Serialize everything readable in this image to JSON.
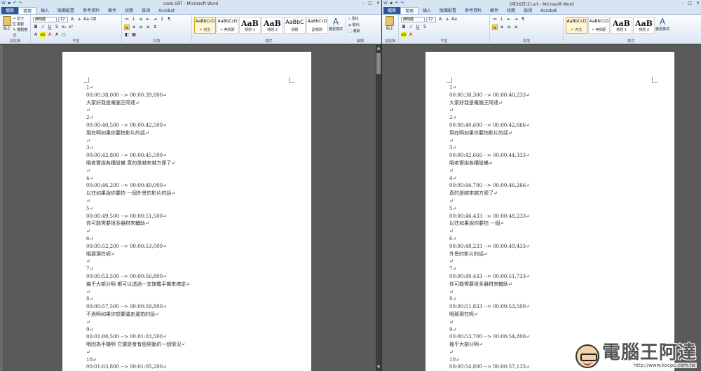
{
  "ribbon": {
    "file_tab": "檔案",
    "tabs": [
      "常用",
      "插入",
      "版面配置",
      "參考資料",
      "郵件",
      "校閱",
      "檢視",
      "Acrobat"
    ],
    "clipboard": {
      "paste": "貼上",
      "cut": "剪下",
      "copy": "複製",
      "format_painter": "複製格式",
      "label": "剪貼簿"
    },
    "font": {
      "name": "細明體",
      "size": "12",
      "label": "字型"
    },
    "paragraph_label": "段落",
    "styles": [
      {
        "preview": "AaBbCcD",
        "name": "↵ 內文"
      },
      {
        "preview": "AaBbCcD",
        "name": "↵ 無間距"
      },
      {
        "preview": "AaB",
        "name": "標題 1"
      },
      {
        "preview": "AaB",
        "name": "標題 2"
      },
      {
        "preview": "AaBbC",
        "name": "標題"
      },
      {
        "preview": "AaBbCcD",
        "name": "副標題"
      }
    ],
    "styles_label": "樣式",
    "change_styles": "變更樣式",
    "editing": {
      "find": "尋找",
      "replace": "取代",
      "select": "選取",
      "label": "編輯"
    }
  },
  "left": {
    "title": "code.SRT - Microsoft Word",
    "lines": [
      "1↵",
      "00:00:38,000 --> 00:00:39,800↵",
      "大家好我是電腦王阿達↵",
      "↵",
      "2↵",
      "00:00:40,500 --> 00:00:42,500↵",
      "現在啊如果你要拍影片的話↵",
      "↵",
      "3↵",
      "00:00:42,800 --> 00:00:45,500↵",
      "哦老實說各種設備 真的是越來越方便了↵",
      "↵",
      "4↵",
      "00:00:46,200 --> 00:00:49,000↵",
      "以往如果說你要拍 一個外景的影片的話↵",
      "↵",
      "5↵",
      "00:00:49,500 --> 00:00:51,500↵",
      "你可能需要很多器材來輔助↵",
      "↵",
      "6↵",
      "00:00:52,200 --> 00:00:53,000↵",
      "哦那現在呢↵",
      "↵",
      "7↵",
      "00:00:53,500 --> 00:00:56,800↵",
      "幾乎大部分啊 都可以透過一支旗艦手機來搞定↵",
      "↵",
      "8↵",
      "00:00:57,500 --> 00:00:59,800↵",
      "不過啊如果你想要邊走邊拍的話↵",
      "↵",
      "9↵",
      "00:01:00,500 --> 00:01:03,500↵",
      "哦因為手機啊 它還是會有個晃動的一個情況↵",
      "↵",
      "10↵",
      "00:01:03,800 --> 00:01:05,200↵"
    ]
  },
  "right": {
    "title": "3月26日(2).srt - Microsoft Word",
    "lines": [
      "1↵",
      "00:00:38,300 --> 00:00:40,233↵",
      "大家好我是電腦王阿達↵",
      "↵",
      "2↵",
      "00:00:40,600 --> 00:00:42,666↵",
      "現在啊如果你要拍影片的話↵",
      "↵",
      "3↵",
      "00:00:42,666 --> 00:00:44,333↵",
      "哦老實說各種設備↵",
      "↵",
      "4↵",
      "00:00:44,700 --> 00:00:46,266↵",
      "真的是越來越方便了↵",
      "↵",
      "5↵",
      "00:00:46,433 --> 00:00:48,233↵",
      "以往如果說你要拍 一個↵",
      "↵",
      "6↵",
      "00:00:48,233 --> 00:00:49,433↵",
      "外景的影片的話↵",
      "↵",
      "7↵",
      "00:00:49,433 --> 00:00:51,733↵",
      "你可能需要很多器材來輔助↵",
      "↵",
      "8↵",
      "00:00:51,833 --> 00:00:53,500↵",
      "哦那現在呢↵",
      "↵",
      "9↵",
      "00:00:53,700 --> 00:00:54,800↵",
      "幾乎大部分啊↵",
      "↵",
      "10↵",
      "00:00:54,800 --> 00:00:57,133↵"
    ]
  },
  "watermark": {
    "title": "電腦王阿達",
    "url": "http://www.kocpc.com.tw"
  },
  "colors": {
    "file_tab": "#2b579a",
    "ribbon_bg": "#dce7f3",
    "doc_bg": "#5a5a5a"
  }
}
